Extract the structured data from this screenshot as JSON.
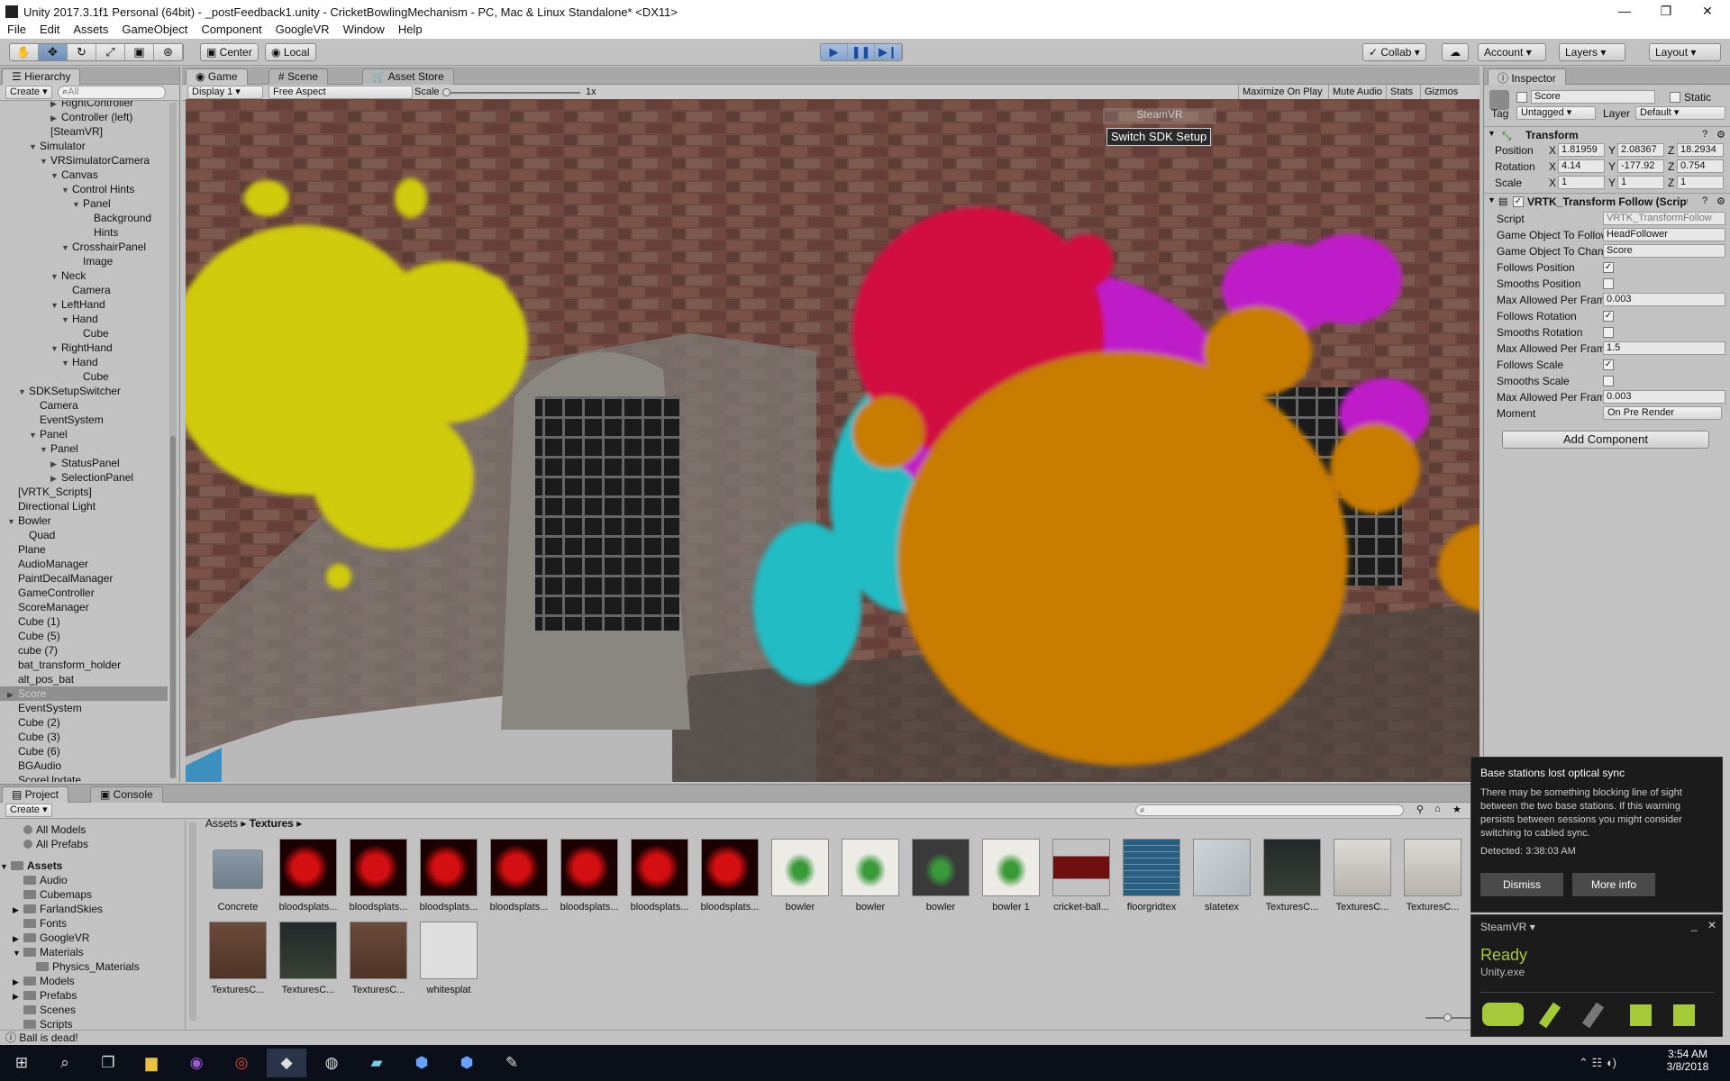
{
  "window": {
    "title": "Unity 2017.3.1f1 Personal (64bit) - _postFeedback1.unity - CricketBowlingMechanism - PC, Mac & Linux Standalone* <DX11>"
  },
  "menu": [
    "File",
    "Edit",
    "Assets",
    "GameObject",
    "Component",
    "GoogleVR",
    "Window",
    "Help"
  ],
  "toolbar": {
    "pivot": "Center",
    "space": "Local",
    "collab": "Collab",
    "account": "Account",
    "layers": "Layers",
    "layout": "Layout"
  },
  "hierarchy": {
    "tab": "Hierarchy",
    "create": "Create",
    "search_placeholder": "All",
    "items": [
      {
        "label": "RightController",
        "indent": 5,
        "arrow": "▶"
      },
      {
        "label": "Controller (left)",
        "indent": 5,
        "arrow": "▶"
      },
      {
        "label": "[SteamVR]",
        "indent": 4,
        "arrow": ""
      },
      {
        "label": "Simulator",
        "indent": 3,
        "arrow": "▼"
      },
      {
        "label": "VRSimulatorCamera",
        "indent": 4,
        "arrow": "▼"
      },
      {
        "label": "Canvas",
        "indent": 5,
        "arrow": "▼"
      },
      {
        "label": "Control Hints",
        "indent": 6,
        "arrow": "▼"
      },
      {
        "label": "Panel",
        "indent": 7,
        "arrow": "▼"
      },
      {
        "label": "Background",
        "indent": 8,
        "arrow": ""
      },
      {
        "label": "Hints",
        "indent": 8,
        "arrow": ""
      },
      {
        "label": "CrosshairPanel",
        "indent": 6,
        "arrow": "▼"
      },
      {
        "label": "Image",
        "indent": 7,
        "arrow": ""
      },
      {
        "label": "Neck",
        "indent": 5,
        "arrow": "▼"
      },
      {
        "label": "Camera",
        "indent": 6,
        "arrow": ""
      },
      {
        "label": "LeftHand",
        "indent": 5,
        "arrow": "▼"
      },
      {
        "label": "Hand",
        "indent": 6,
        "arrow": "▼"
      },
      {
        "label": "Cube",
        "indent": 7,
        "arrow": ""
      },
      {
        "label": "RightHand",
        "indent": 5,
        "arrow": "▼"
      },
      {
        "label": "Hand",
        "indent": 6,
        "arrow": "▼"
      },
      {
        "label": "Cube",
        "indent": 7,
        "arrow": ""
      },
      {
        "label": "SDKSetupSwitcher",
        "indent": 2,
        "arrow": "▼"
      },
      {
        "label": "Camera",
        "indent": 3,
        "arrow": ""
      },
      {
        "label": "EventSystem",
        "indent": 3,
        "arrow": ""
      },
      {
        "label": "Panel",
        "indent": 3,
        "arrow": "▼"
      },
      {
        "label": "Panel",
        "indent": 4,
        "arrow": "▼"
      },
      {
        "label": "StatusPanel",
        "indent": 5,
        "arrow": "▶"
      },
      {
        "label": "SelectionPanel",
        "indent": 5,
        "arrow": "▶"
      },
      {
        "label": "[VRTK_Scripts]",
        "indent": 1,
        "arrow": ""
      },
      {
        "label": "Directional Light",
        "indent": 1,
        "arrow": ""
      },
      {
        "label": "Bowler",
        "indent": 1,
        "arrow": "▼"
      },
      {
        "label": "Quad",
        "indent": 2,
        "arrow": ""
      },
      {
        "label": "Plane",
        "indent": 1,
        "arrow": ""
      },
      {
        "label": "AudioManager",
        "indent": 1,
        "arrow": ""
      },
      {
        "label": "PaintDecalManager",
        "indent": 1,
        "arrow": ""
      },
      {
        "label": "GameController",
        "indent": 1,
        "arrow": ""
      },
      {
        "label": "ScoreManager",
        "indent": 1,
        "arrow": ""
      },
      {
        "label": "Cube (1)",
        "indent": 1,
        "arrow": ""
      },
      {
        "label": "Cube (5)",
        "indent": 1,
        "arrow": ""
      },
      {
        "label": "cube (7)",
        "indent": 1,
        "arrow": ""
      },
      {
        "label": "bat_transform_holder",
        "indent": 1,
        "arrow": ""
      },
      {
        "label": "alt_pos_bat",
        "indent": 1,
        "arrow": ""
      },
      {
        "label": "Score",
        "indent": 1,
        "arrow": "▶",
        "selected": true
      },
      {
        "label": "EventSystem",
        "indent": 1,
        "arrow": ""
      },
      {
        "label": "Cube (2)",
        "indent": 1,
        "arrow": ""
      },
      {
        "label": "Cube (3)",
        "indent": 1,
        "arrow": ""
      },
      {
        "label": "Cube (6)",
        "indent": 1,
        "arrow": ""
      },
      {
        "label": "BGAudio",
        "indent": 1,
        "arrow": ""
      },
      {
        "label": "ScoreUpdate",
        "indent": 1,
        "arrow": ""
      }
    ]
  },
  "game": {
    "tabs": [
      "Game",
      "Scene",
      "Asset Store"
    ],
    "display": "Display 1",
    "aspect": "Free Aspect",
    "scale_label": "Scale",
    "scale_value": "1x",
    "buttons": [
      "Maximize On Play",
      "Mute Audio",
      "Stats",
      "Gizmos"
    ],
    "sdk_label": "SteamVR",
    "sdk_button": "Switch SDK Setup"
  },
  "inspector": {
    "tab": "Inspector",
    "object_name": "Score",
    "static_label": "Static",
    "tag_label": "Tag",
    "tag_value": "Untagged",
    "layer_label": "Layer",
    "layer_value": "Default",
    "transform": {
      "title": "Transform",
      "position": {
        "label": "Position",
        "x": "1.81959",
        "y": "2.08367",
        "z": "18.2934"
      },
      "rotation": {
        "label": "Rotation",
        "x": "4.14",
        "y": "-177.92",
        "z": "0.754"
      },
      "scale": {
        "label": "Scale",
        "x": "1",
        "y": "1",
        "z": "1"
      }
    },
    "component": {
      "title": "VRTK_Transform Follow (Script)",
      "rows": [
        {
          "label": "Script",
          "value": "VRTK_TransformFollow",
          "kind": "field"
        },
        {
          "label": "Game Object To Follow",
          "value": "HeadFollower",
          "kind": "field"
        },
        {
          "label": "Game Object To Change",
          "value": "Score",
          "kind": "field"
        },
        {
          "label": "Follows Position",
          "checked": true,
          "kind": "check"
        },
        {
          "label": "Smooths Position",
          "checked": false,
          "kind": "check"
        },
        {
          "label": "Max Allowed Per Frame",
          "value": "0.003",
          "kind": "field"
        },
        {
          "label": "Follows Rotation",
          "checked": true,
          "kind": "check"
        },
        {
          "label": "Smooths Rotation",
          "checked": false,
          "kind": "check"
        },
        {
          "label": "Max Allowed Per Frame",
          "value": "1.5",
          "kind": "field"
        },
        {
          "label": "Follows Scale",
          "checked": true,
          "kind": "check"
        },
        {
          "label": "Smooths Scale",
          "checked": false,
          "kind": "check"
        },
        {
          "label": "Max Allowed Per Frame",
          "value": "0.003",
          "kind": "field"
        },
        {
          "label": "Moment",
          "value": "On Pre Render",
          "kind": "dropdown"
        }
      ]
    },
    "add_component": "Add Component"
  },
  "project": {
    "tabs": [
      "Project",
      "Console"
    ],
    "create": "Create",
    "favorites": [
      "All Models",
      "All Prefabs"
    ],
    "root": "Assets",
    "folders": [
      "Audio",
      "Cubemaps",
      "FarlandSkies",
      "Fonts",
      "GoogleVR",
      "Materials",
      "Physics_Materials",
      "Models",
      "Prefabs",
      "Scenes",
      "Scripts"
    ],
    "breadcrumb": [
      "Assets",
      "Textures"
    ],
    "assets": [
      {
        "label": "Concrete",
        "kind": "folder"
      },
      {
        "label": "bloodsplats...",
        "kind": "splat"
      },
      {
        "label": "bloodsplats...",
        "kind": "splat"
      },
      {
        "label": "bloodsplats...",
        "kind": "splat"
      },
      {
        "label": "bloodsplats...",
        "kind": "splat"
      },
      {
        "label": "bloodsplats...",
        "kind": "splat"
      },
      {
        "label": "bloodsplats...",
        "kind": "splat"
      },
      {
        "label": "bloodsplats...",
        "kind": "splat"
      },
      {
        "label": "bowler",
        "kind": "bowler"
      },
      {
        "label": "bowler",
        "kind": "bowler"
      },
      {
        "label": "bowler",
        "kind": "bowler-dark"
      },
      {
        "label": "bowler 1",
        "kind": "bowler"
      },
      {
        "label": "cricket-ball...",
        "kind": "ball"
      },
      {
        "label": "floorgridtex",
        "kind": "grid"
      },
      {
        "label": "slatetex",
        "kind": "slate"
      },
      {
        "label": "TexturesC...",
        "kind": "bld-dark"
      },
      {
        "label": "TexturesC...",
        "kind": "bld-light"
      },
      {
        "label": "TexturesC...",
        "kind": "bld-light"
      },
      {
        "label": "TexturesC...",
        "kind": "bld-brown"
      },
      {
        "label": "TexturesC...",
        "kind": "bld-dark"
      },
      {
        "label": "TexturesC...",
        "kind": "bld-brown"
      },
      {
        "label": "whitesplat",
        "kind": "white"
      }
    ]
  },
  "status": {
    "message": "Ball is dead!"
  },
  "notification": {
    "title": "Base stations lost optical sync",
    "body": "There may be something blocking line of sight between the two base stations. If this warning persists between sessions you might consider switching to cabled sync.",
    "detected": "Detected: 3:38:03 AM",
    "dismiss": "Dismiss",
    "more": "More info"
  },
  "steamvr": {
    "title": "SteamVR",
    "status": "Ready",
    "app": "Unity.exe",
    "status_color": "#a6c93a"
  },
  "taskbar": {
    "time": "3:54 AM",
    "date": "3/8/2018"
  }
}
